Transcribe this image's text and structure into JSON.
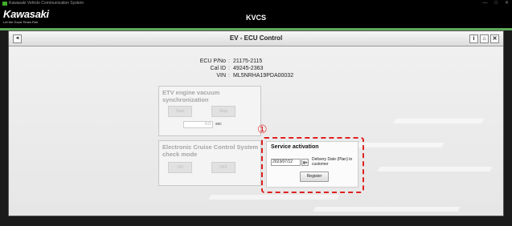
{
  "os_window": {
    "title": "Kawasaki Vehicle Communication System",
    "controls": [
      "—",
      "□",
      "✕"
    ]
  },
  "header": {
    "brand": "Kawasaki",
    "tagline": "Let the Good Times Roll",
    "app_title": "KVCS",
    "accent_color": "#5ea85a"
  },
  "nav": {
    "back_icon": "◄",
    "title": "EV - ECU Control",
    "icons": [
      {
        "name": "info-icon",
        "glyph": "i"
      },
      {
        "name": "home-icon",
        "glyph": "⌂"
      },
      {
        "name": "close-icon",
        "glyph": "✕"
      }
    ]
  },
  "ecu_info": [
    {
      "label": "ECU P/No",
      "value": "21175-2115"
    },
    {
      "label": "Cal ID",
      "value": "49245-2363"
    },
    {
      "label": "VIN",
      "value": "ML5NRHA19PDA00032"
    }
  ],
  "etv_box": {
    "title": "ETV engine vacuum synchronization",
    "start_label": "Start",
    "stop_label": "Stop",
    "sec_value": "0.0",
    "sec_unit": "sec"
  },
  "cruise_box": {
    "title": "Electronic Cruise Control System check mode",
    "on_label": "ON",
    "off_label": "OFF"
  },
  "annotation": {
    "marker": "①",
    "color": "#e02020"
  },
  "service": {
    "title": "Service activation",
    "date_value": "2023/07/12",
    "dropdown_icon": "▦▾",
    "delivery_label": "Delivery Date (Plan) to customer",
    "register_label": "Register"
  }
}
